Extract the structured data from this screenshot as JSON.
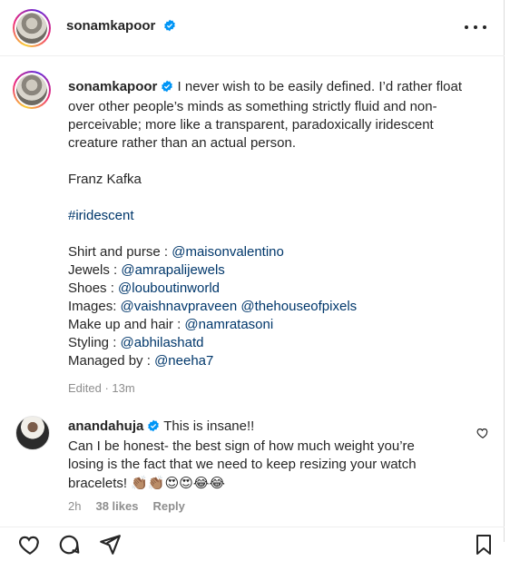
{
  "header": {
    "username": "sonamkapoor",
    "more_icon": "more-horizontal-icon"
  },
  "caption": {
    "username": "sonamkapoor",
    "lines": [
      "I never wish to be easily defined. I’d rather float",
      "over other people’s minds as something strictly fluid and non-",
      "perceivable; more like a transparent, paradoxically iridescent",
      "creature rather than an actual person."
    ],
    "author": "Franz Kafka",
    "hashtag": "#iridescent",
    "credits": [
      {
        "label": "Shirt and purse : ",
        "handle": "@maisonvalentino"
      },
      {
        "label": "Jewels : ",
        "handle": "@amrapalijewels"
      },
      {
        "label": "Shoes : ",
        "handle": "@louboutinworld"
      },
      {
        "label": "Images: ",
        "handle": "@vaishnavpraveen",
        "handle2": "@thehouseofpixels"
      },
      {
        "label": "Make up and hair : ",
        "handle": "@namratasoni"
      },
      {
        "label": "Styling : ",
        "handle": "@abhilashatd"
      },
      {
        "label": "Managed by : ",
        "handle": "@neeha7"
      }
    ],
    "meta": "Edited · 13m"
  },
  "comment": {
    "username": "anandahuja",
    "first": "This is insane!!",
    "lines": [
      "Can I be honest- the best sign of how much weight you’re",
      "losing is the fact that we need to keep resizing your watch",
      "bracelets!"
    ],
    "emojis": "👏🏽👏🏽😍😍😂😂",
    "time": "2h",
    "likes": "38 likes",
    "reply": "Reply"
  },
  "colors": {
    "link": "#00376b",
    "verified": "#0095f6",
    "muted": "#8e8e8e"
  }
}
